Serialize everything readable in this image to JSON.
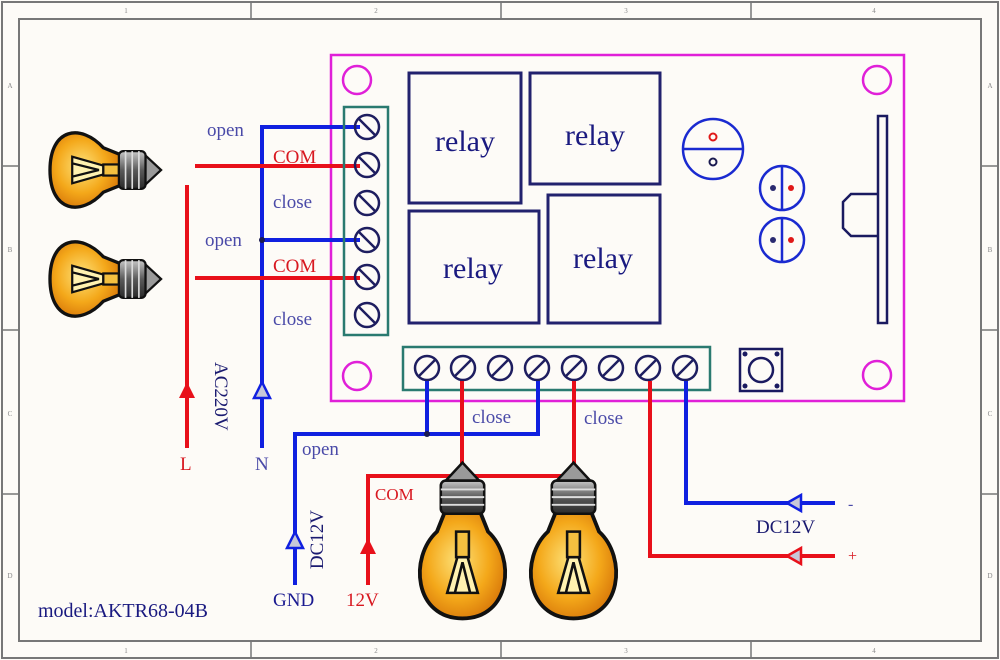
{
  "frame": {
    "column_markers": [
      "1",
      "2",
      "3",
      "4"
    ],
    "row_markers": [
      "A",
      "B",
      "C",
      "D"
    ]
  },
  "colors": {
    "background": "#fdfbf7",
    "frame": "#777777",
    "board": "#e020d8",
    "terminal_block": "#2a7a70",
    "component": "#1e1e78",
    "wire_live": "#e8101a",
    "wire_neutral": "#1020e0",
    "label_blue": "#4a4aa8",
    "label_red": "#d81820",
    "label_navy": "#1a1a70",
    "bulb_fill": "#f4a81a"
  },
  "board": {
    "relays": [
      {
        "label": "relay"
      },
      {
        "label": "relay"
      },
      {
        "label": "relay"
      },
      {
        "label": "relay"
      }
    ]
  },
  "left_terminals": {
    "labels": [
      {
        "text": "open",
        "color": "blue"
      },
      {
        "text": "COM",
        "color": "red"
      },
      {
        "text": "close",
        "color": "blue"
      },
      {
        "text": "open",
        "color": "blue"
      },
      {
        "text": "COM",
        "color": "red"
      },
      {
        "text": "close",
        "color": "blue"
      }
    ]
  },
  "ac_supply": {
    "voltage_label": "AC220V",
    "live_label": "L",
    "neutral_label": "N"
  },
  "bottom_wiring": {
    "close_label_1": "close",
    "close_label_2": "close",
    "open_label": "open",
    "com_label": "COM",
    "dc_label": "DC12V",
    "gnd_label": "GND",
    "v12_label": "12V"
  },
  "dc_input": {
    "minus_label": "-",
    "plus_label": "+",
    "dc_label": "DC12V"
  },
  "model": {
    "text": "model:AKTR68-04B"
  }
}
